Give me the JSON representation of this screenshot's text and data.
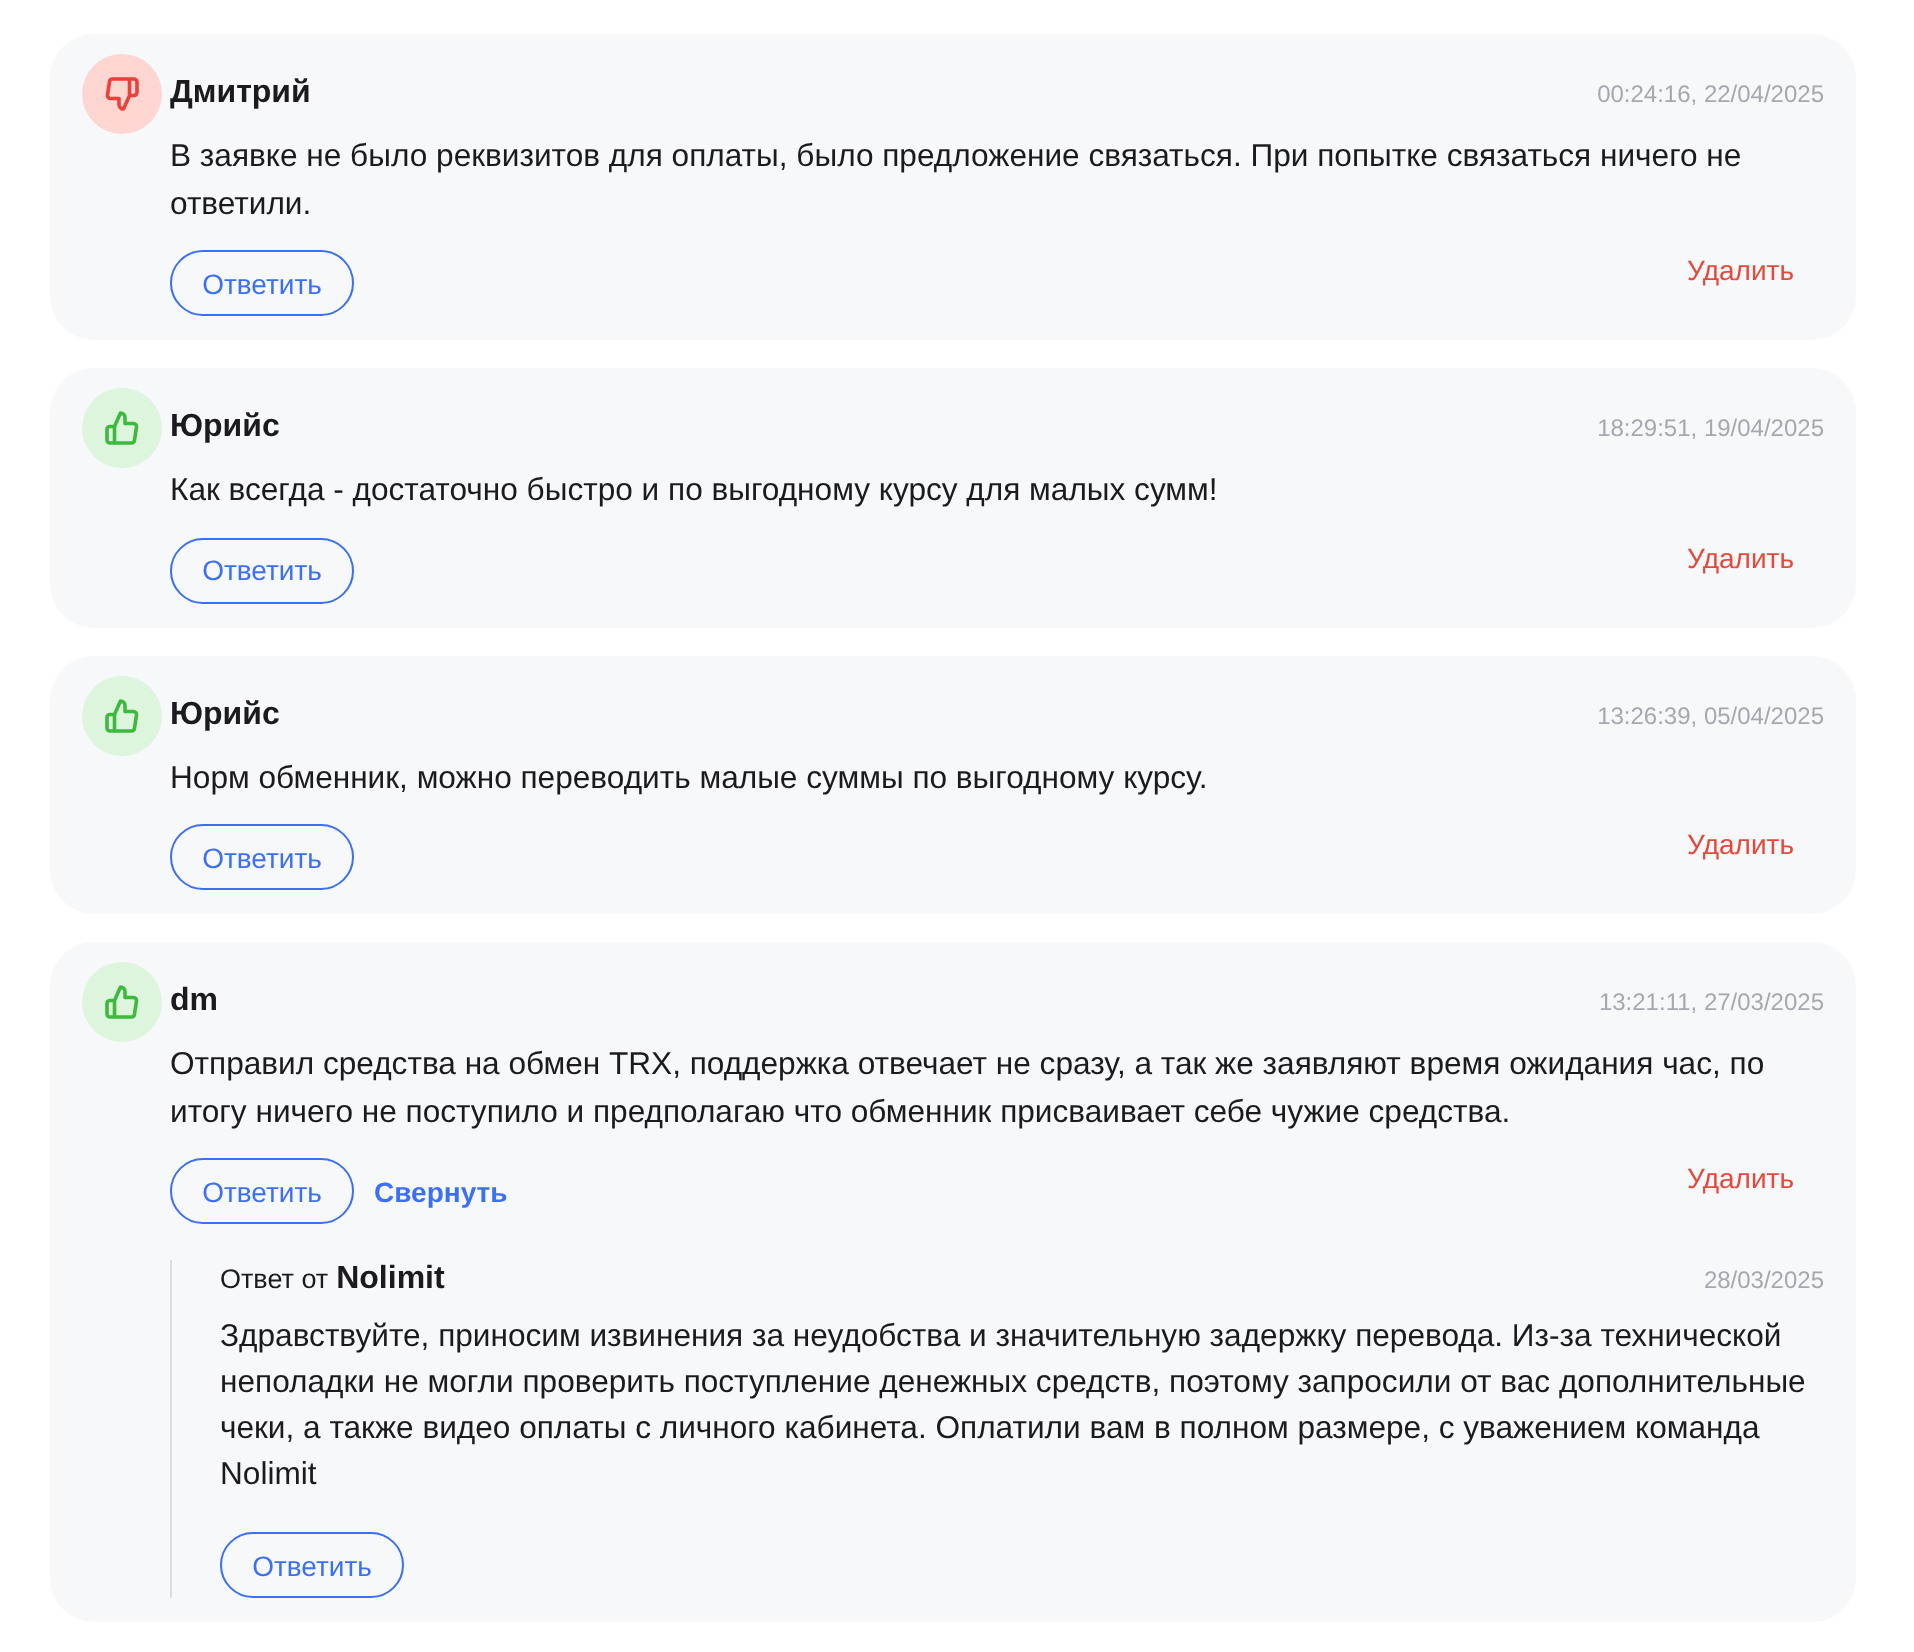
{
  "reviews": [
    {
      "kind": "negative",
      "author": "Дмитрий",
      "time": "00:24:16, 22/04/2025",
      "text": "В заявке не было реквизитов для оплаты, было предложение связаться. При попытке связаться ничего не ответили.",
      "reply_button": "Ответить",
      "delete_link": "Удалить"
    },
    {
      "kind": "positive",
      "author": "Юрийс",
      "time": "18:29:51, 19/04/2025",
      "text": "Как всегда - достаточно быстро и по выгодному курсу для малых сумм!",
      "reply_button": "Ответить",
      "delete_link": "Удалить"
    },
    {
      "kind": "positive",
      "author": "Юрийс",
      "time": "13:26:39, 05/04/2025",
      "text": "Норм обменник, можно переводить малые суммы по выгодному курсу.",
      "reply_button": "Ответить",
      "delete_link": "Удалить"
    },
    {
      "kind": "positive",
      "author": "dm",
      "time": "13:21:11, 27/03/2025",
      "text": "Отправил средства на обмен TRX, поддержка отвечает не сразу, а так же заявляют время ожидания час, по итогу ничего не поступило и предполагаю что обменник присваивает себе чужие средства.",
      "reply_button": "Ответить",
      "collapse_link": "Свернуть",
      "delete_link": "Удалить",
      "answer": {
        "label": "Ответ от",
        "author": "Nolimit",
        "date": "28/03/2025",
        "text": "Здравствуйте, приносим извинения за неудобства и значительную задержку перевода. Из-за технической неполадки не могли проверить поступление денежных средств, поэтому запросили от вас дополнительные чеки, а также видео оплаты с личного кабинета. Оплатили вам в полном размере, с уважением команда Nolimit",
        "reply_button": "Ответить"
      }
    }
  ]
}
